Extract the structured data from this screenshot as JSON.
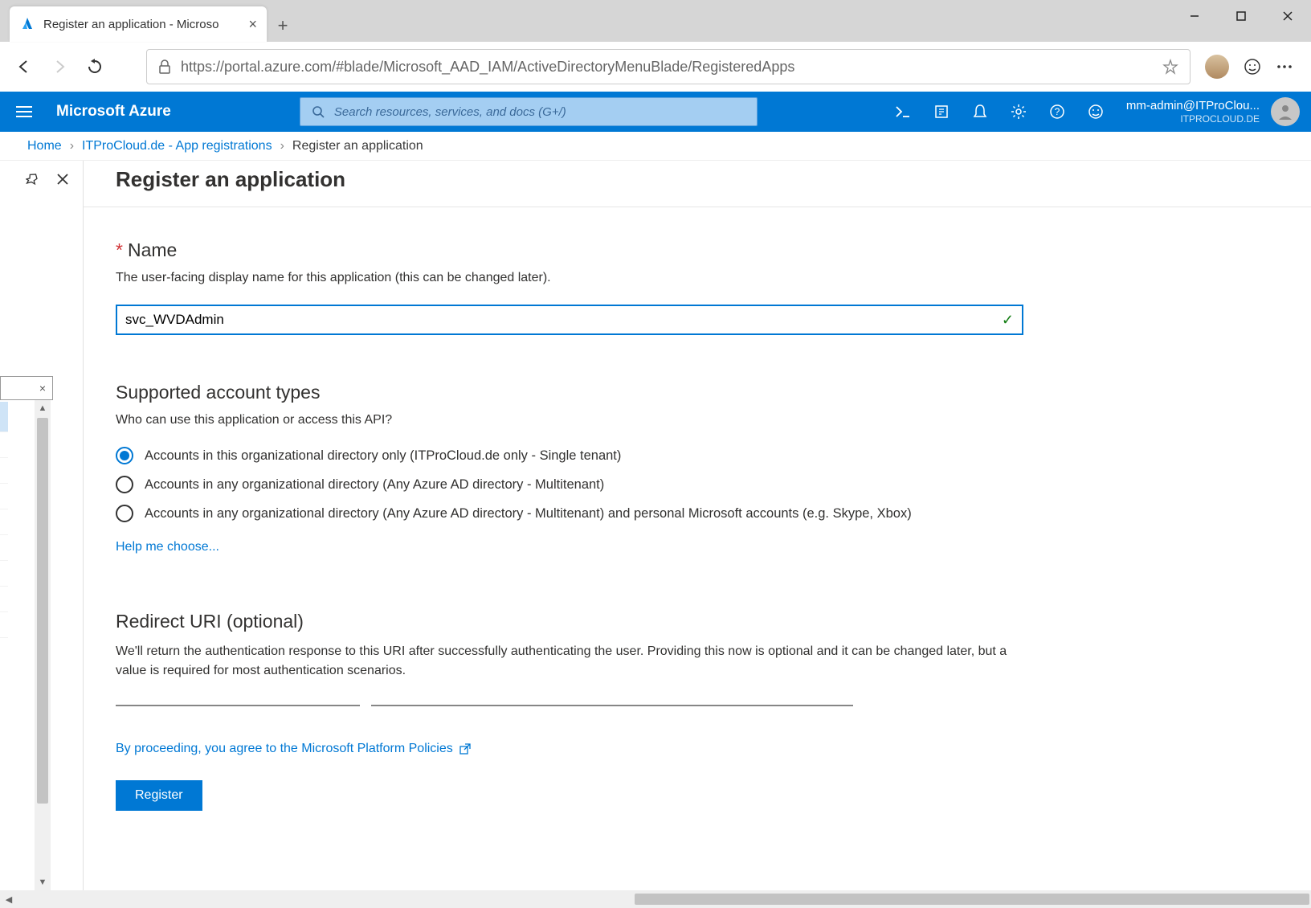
{
  "browser": {
    "tab_title": "Register an application - Microso",
    "url_display": "https://portal.azure.com/#blade/Microsoft_AAD_IAM/ActiveDirectoryMenuBlade/RegisteredApps"
  },
  "azure": {
    "brand": "Microsoft Azure",
    "search_placeholder": "Search resources, services, and docs (G+/)",
    "account_line1": "mm-admin@ITProClou...",
    "account_line2": "ITPROCLOUD.DE"
  },
  "breadcrumb": {
    "item1": "Home",
    "item2": "ITProCloud.de - App registrations",
    "current": "Register an application"
  },
  "blade": {
    "title": "Register an application"
  },
  "name_section": {
    "heading": "Name",
    "hint": "The user-facing display name for this application (this can be changed later).",
    "value": "svc_WVDAdmin"
  },
  "account_types": {
    "heading": "Supported account types",
    "hint": "Who can use this application or access this API?",
    "option1": "Accounts in this organizational directory only (ITProCloud.de only - Single tenant)",
    "option2": "Accounts in any organizational directory (Any Azure AD directory - Multitenant)",
    "option3": "Accounts in any organizational directory (Any Azure AD directory - Multitenant) and personal Microsoft accounts (e.g. Skype, Xbox)",
    "help_link": "Help me choose..."
  },
  "redirect": {
    "heading": "Redirect URI (optional)",
    "hint": "We'll return the authentication response to this URI after successfully authenticating the user. Providing this now is optional and it can be changed later, but a value is required for most authentication scenarios."
  },
  "footer": {
    "policy_text": "By proceeding, you agree to the Microsoft Platform Policies",
    "register_label": "Register"
  }
}
